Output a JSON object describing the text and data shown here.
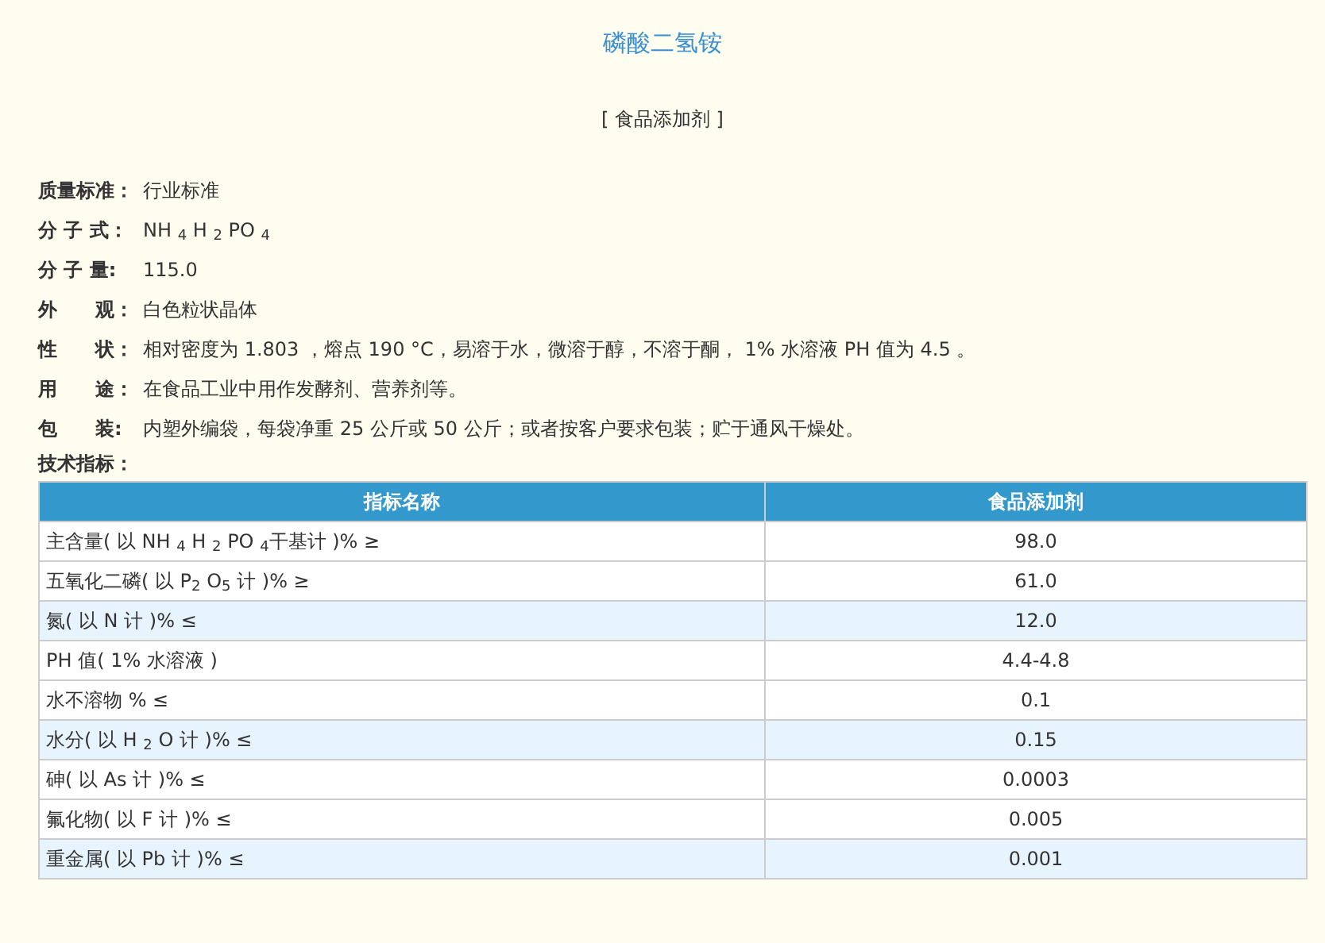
{
  "title": "磷酸二氢铵",
  "subtitle": "[ 食品添加剂 ]",
  "properties": [
    {
      "label": "质量标准：",
      "value": "行业标准"
    },
    {
      "label": "分 子 式：",
      "value": "NH $_{4}$ H $_{2}$ PO $_{4}$"
    },
    {
      "label": "分 子 量:",
      "value": "115.0"
    },
    {
      "label": "外　　观：",
      "value": "白色粒状晶体"
    },
    {
      "label": "性　　状：",
      "value": "相对密度为 1.803 ，熔点 190 °C，易溶于水，微溶于醇，不溶于酮， 1% 水溶液 PH 值为 4.5 。"
    },
    {
      "label": "用　　途：",
      "value": "在食品工业中用作发酵剂、营养剂等。"
    },
    {
      "label": "包　　装:",
      "value": "内塑外编袋，每袋净重 25 公斤或 50 公斤；或者按客户要求包装；贮于通风干燥处。"
    }
  ],
  "spec_heading": "技术指标：",
  "table": {
    "columns": [
      "指标名称",
      "食品添加剂"
    ],
    "rows": [
      {
        "cells": [
          "主含量( 以 NH $_{4}$ H $_{2}$ PO $_{4}$干基计 )% ≥",
          "98.0"
        ],
        "shaded": false
      },
      {
        "cells": [
          "五氧化二磷( 以 P$_{2}$ O$_{5}$ 计 )% ≥",
          "61.0"
        ],
        "shaded": false
      },
      {
        "cells": [
          "氮( 以 N 计 )% ≤",
          "12.0"
        ],
        "shaded": true
      },
      {
        "cells": [
          "PH 值( 1% 水溶液 )",
          "4.4-4.8"
        ],
        "shaded": false
      },
      {
        "cells": [
          "水不溶物 % ≤",
          "0.1"
        ],
        "shaded": false
      },
      {
        "cells": [
          "水分( 以 H $_{2}$ O 计 )% ≤",
          "0.15"
        ],
        "shaded": true
      },
      {
        "cells": [
          "砷( 以 As 计 )% ≤",
          "0.0003"
        ],
        "shaded": false
      },
      {
        "cells": [
          "氟化物( 以 F 计 )% ≤",
          "0.005"
        ],
        "shaded": false
      },
      {
        "cells": [
          "重金属( 以 Pb 计 )% ≤",
          "0.001"
        ],
        "shaded": true
      }
    ]
  }
}
